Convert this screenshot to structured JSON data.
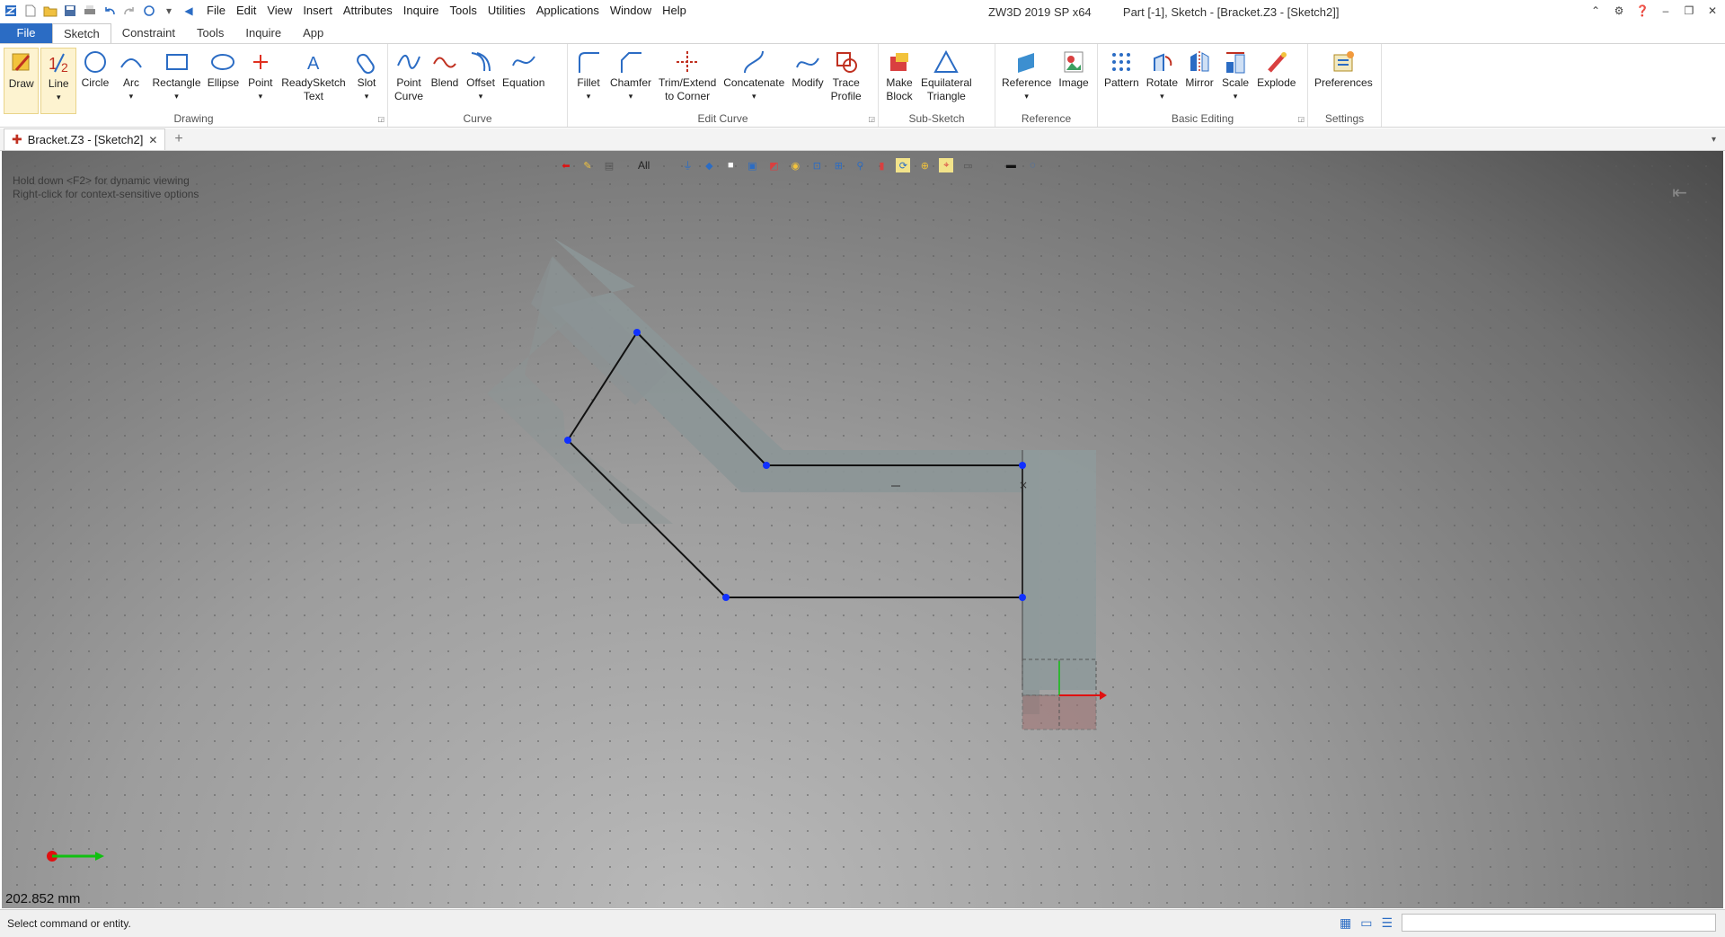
{
  "app": {
    "title": "ZW3D 2019 SP x64",
    "doc_title": "Part [-1],  Sketch - [Bracket.Z3 - [Sketch2]]"
  },
  "menu": [
    "File",
    "Edit",
    "View",
    "Insert",
    "Attributes",
    "Inquire",
    "Tools",
    "Utilities",
    "Applications",
    "Window",
    "Help"
  ],
  "ribbon_tabs": [
    "File",
    "Sketch",
    "Constraint",
    "Tools",
    "Inquire",
    "App"
  ],
  "active_tab": "Sketch",
  "groups": {
    "drawing": {
      "label": "Drawing",
      "buttons": [
        "Draw",
        "Line",
        "Circle",
        "Arc",
        "Rectangle",
        "Ellipse",
        "Point",
        "ReadySketch\nText",
        "Slot"
      ]
    },
    "curve": {
      "label": "Curve",
      "buttons": [
        "Point\nCurve",
        "Blend",
        "Offset",
        "Equation"
      ]
    },
    "edit_curve": {
      "label": "Edit Curve",
      "buttons": [
        "Fillet",
        "Chamfer",
        "Trim/Extend\nto Corner",
        "Concatenate",
        "Modify",
        "Trace\nProfile"
      ]
    },
    "sub_sketch": {
      "label": "Sub-Sketch",
      "buttons": [
        "Make\nBlock",
        "Equilateral\nTriangle"
      ]
    },
    "reference": {
      "label": "Reference",
      "buttons": [
        "Reference",
        "Image"
      ]
    },
    "basic_editing": {
      "label": "Basic Editing",
      "buttons": [
        "Pattern",
        "Rotate",
        "Mirror",
        "Scale",
        "Explode"
      ]
    },
    "settings": {
      "label": "Settings",
      "buttons": [
        "Preferences"
      ]
    }
  },
  "doc_tab": "Bracket.Z3 - [Sketch2]",
  "viewport": {
    "filter_label": "All",
    "hint_line1": "Hold down <F2> for dynamic viewing",
    "hint_line2": "Right-click for context-sensitive options",
    "distance": "202.852 mm"
  },
  "status": {
    "text": "Select command or entity."
  },
  "colors": {
    "file_tab": "#2b6cc4",
    "accent": "#2b6cc4",
    "point": "#1030ff",
    "x_axis": "#e01010",
    "y_axis": "#10c010"
  }
}
